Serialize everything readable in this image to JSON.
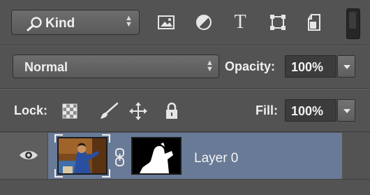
{
  "filter": {
    "kind_label": "Kind",
    "icons": [
      "image-filter-icon",
      "adjustment-filter-icon",
      "type-filter-icon",
      "shape-filter-icon",
      "smart-object-filter-icon"
    ],
    "type_glyph": "T"
  },
  "blend": {
    "mode": "Normal",
    "opacity_label": "Opacity:",
    "opacity_value": "100%"
  },
  "lock": {
    "label": "Lock:",
    "fill_label": "Fill:",
    "fill_value": "100%"
  },
  "layers": [
    {
      "name": "Layer 0",
      "selected": true,
      "visible": true
    }
  ],
  "colors": {
    "panel": "#535353",
    "selected_row": "#687a96"
  }
}
